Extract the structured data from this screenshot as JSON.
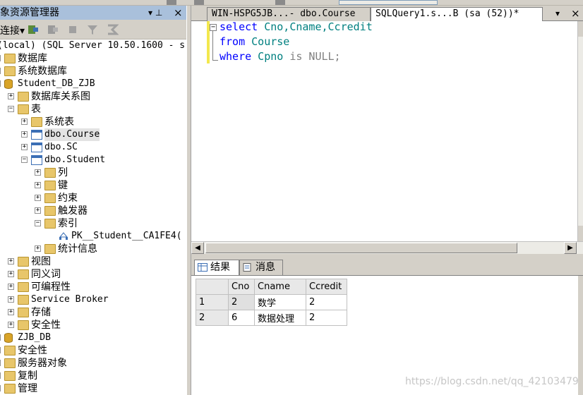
{
  "object_explorer": {
    "title": "象资源管理器",
    "pin_glyph": "▾ ⊥",
    "close_glyph": "×",
    "connect_label": "连接▾",
    "tree": [
      {
        "label": "(local) (SQL Server 10.50.1600 - s",
        "icon": "server-icon",
        "expander": "",
        "mono": true
      },
      {
        "label": "数据库",
        "icon": "folder-icon",
        "expander": "−"
      },
      {
        "label": "系统数据库",
        "icon": "folder-icon",
        "expander": "+"
      },
      {
        "label": "Student_DB_ZJB",
        "icon": "database-icon",
        "expander": "−",
        "mono": true
      },
      {
        "label": "数据库关系图",
        "icon": "folder-icon",
        "expander": "+"
      },
      {
        "label": "表",
        "icon": "folder-icon",
        "expander": "−"
      },
      {
        "label": "系统表",
        "icon": "folder-icon",
        "expander": "+"
      },
      {
        "label": "dbo.Course",
        "icon": "table-icon",
        "expander": "+",
        "mono": true,
        "selected": true
      },
      {
        "label": "dbo.SC",
        "icon": "table-icon",
        "expander": "+",
        "mono": true
      },
      {
        "label": "dbo.Student",
        "icon": "table-icon",
        "expander": "−",
        "mono": true
      },
      {
        "label": "列",
        "icon": "folder-icon",
        "expander": "+"
      },
      {
        "label": "键",
        "icon": "folder-icon",
        "expander": "+"
      },
      {
        "label": "约束",
        "icon": "folder-icon",
        "expander": "+"
      },
      {
        "label": "触发器",
        "icon": "folder-icon",
        "expander": "+"
      },
      {
        "label": "索引",
        "icon": "folder-icon",
        "expander": "−"
      },
      {
        "label": "PK__Student__CA1FE4(",
        "icon": "index-icon",
        "expander": "",
        "mono": true
      },
      {
        "label": "统计信息",
        "icon": "folder-icon",
        "expander": "+"
      },
      {
        "label": "视图",
        "icon": "folder-icon",
        "expander": "+"
      },
      {
        "label": "同义词",
        "icon": "folder-icon",
        "expander": "+"
      },
      {
        "label": "可编程性",
        "icon": "folder-icon",
        "expander": "+"
      },
      {
        "label": "Service Broker",
        "icon": "folder-icon",
        "expander": "+",
        "mono": true
      },
      {
        "label": "存储",
        "icon": "folder-icon",
        "expander": "+"
      },
      {
        "label": "安全性",
        "icon": "folder-icon",
        "expander": "+"
      },
      {
        "label": "ZJB_DB",
        "icon": "database-icon",
        "expander": "+",
        "mono": true
      },
      {
        "label": "安全性",
        "icon": "folder-icon",
        "expander": "+"
      },
      {
        "label": "服务器对象",
        "icon": "folder-icon",
        "expander": "+"
      },
      {
        "label": "复制",
        "icon": "folder-icon",
        "expander": "+"
      },
      {
        "label": "管理",
        "icon": "folder-icon",
        "expander": "+"
      }
    ]
  },
  "doc_tabs": {
    "course_tab": "WIN-HSPG5JB...- dbo.Course",
    "query_tab": "SQLQuery1.s...B (sa (52))*",
    "dropdown_glyph": "▾",
    "close_glyph": "×"
  },
  "editor": {
    "collapse_glyph": "−",
    "line1": {
      "kw": "select",
      "rest": " Cno,Cname,Ccredit"
    },
    "line2": {
      "kw": "from",
      "rest": " Course"
    },
    "line3": {
      "kw": "where",
      "id": " Cpno",
      "gray": " is NULL;"
    }
  },
  "results_tabs": {
    "results_label": "结果",
    "messages_label": "消息"
  },
  "results_grid": {
    "columns": [
      "Cno",
      "Cname",
      "Ccredit"
    ],
    "rows": [
      {
        "num": "1",
        "cells": [
          "2",
          "数学",
          "2"
        ]
      },
      {
        "num": "2",
        "cells": [
          "6",
          "数据处理",
          "2"
        ]
      }
    ]
  },
  "watermark": "https://blog.csdn.net/qq_42103479",
  "colors": {
    "keyword": "#0000ff",
    "identifier": "#008080",
    "operator": "#808080",
    "oe_title_bg": "#a9c0db",
    "change_bar": "#f3e84e"
  }
}
